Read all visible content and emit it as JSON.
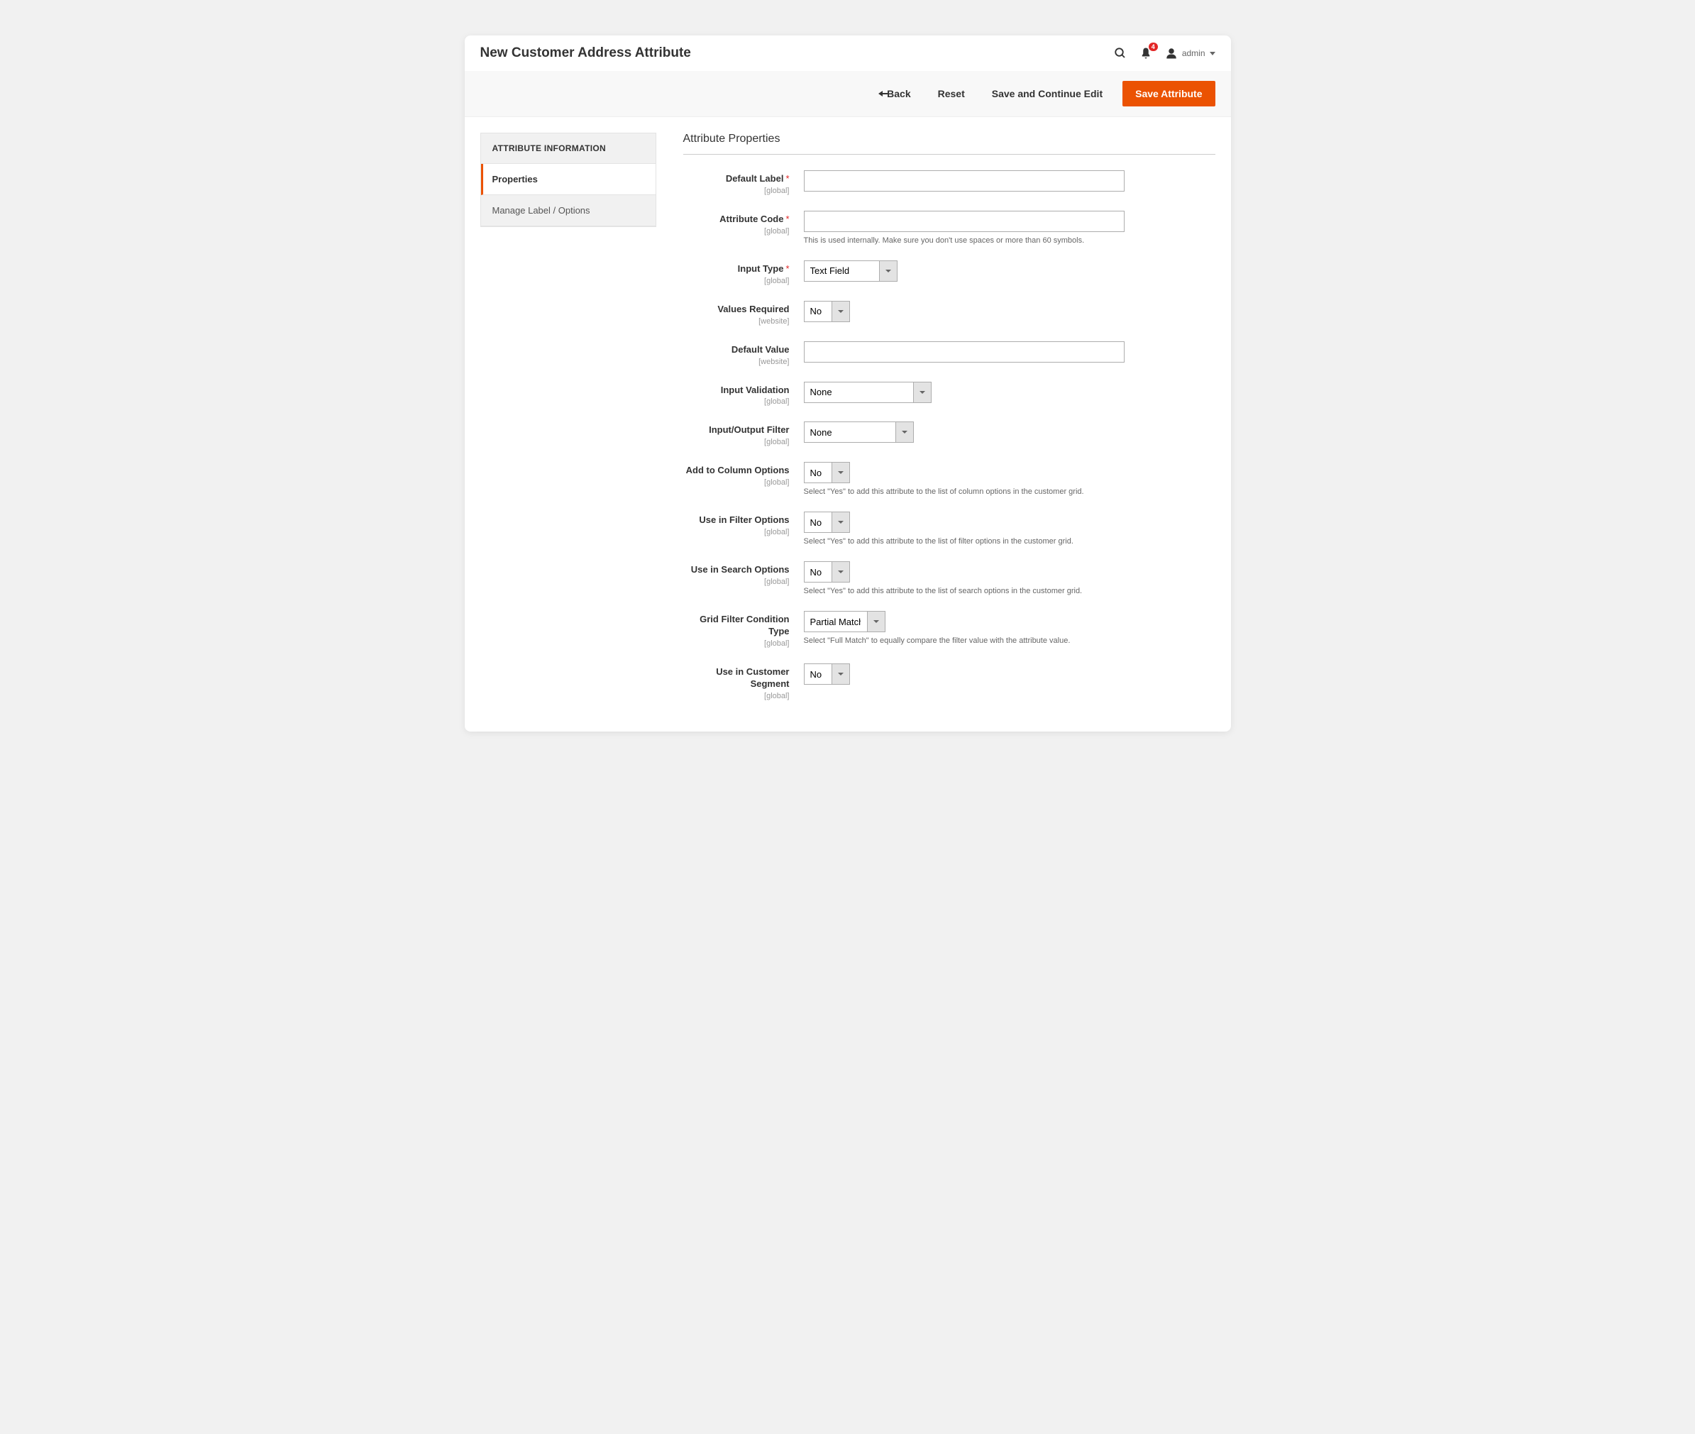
{
  "header": {
    "title": "New Customer Address Attribute",
    "notification_count": "4",
    "username": "admin"
  },
  "actions": {
    "back": "Back",
    "reset": "Reset",
    "save_continue": "Save and Continue Edit",
    "save": "Save Attribute"
  },
  "sidebar": {
    "title": "ATTRIBUTE INFORMATION",
    "tabs": {
      "properties": "Properties",
      "manage": "Manage Label / Options"
    }
  },
  "section": {
    "title": "Attribute Properties"
  },
  "scopes": {
    "global": "[global]",
    "website": "[website]"
  },
  "fields": {
    "default_label": {
      "label": "Default Label",
      "value": ""
    },
    "attribute_code": {
      "label": "Attribute Code",
      "value": "",
      "help": "This is used internally. Make sure you don't use spaces or more than 60 symbols."
    },
    "input_type": {
      "label": "Input Type",
      "value": "Text Field"
    },
    "values_required": {
      "label": "Values Required",
      "value": "No"
    },
    "default_value": {
      "label": "Default Value",
      "value": ""
    },
    "input_validation": {
      "label": "Input Validation",
      "value": "None"
    },
    "io_filter": {
      "label": "Input/Output Filter",
      "value": "None"
    },
    "add_column": {
      "label": "Add to Column Options",
      "value": "No",
      "help": "Select \"Yes\" to add this attribute to the list of column options in the customer grid."
    },
    "use_filter": {
      "label": "Use in Filter Options",
      "value": "No",
      "help": "Select \"Yes\" to add this attribute to the list of filter options in the customer grid."
    },
    "use_search": {
      "label": "Use in Search Options",
      "value": "No",
      "help": "Select \"Yes\" to add this attribute to the list of search options in the customer grid."
    },
    "grid_filter": {
      "label": "Grid Filter Condition Type",
      "value": "Partial Match",
      "help": "Select \"Full Match\" to equally compare the filter value with the attribute value."
    },
    "customer_segment": {
      "label": "Use in Customer Segment",
      "value": "No"
    }
  }
}
